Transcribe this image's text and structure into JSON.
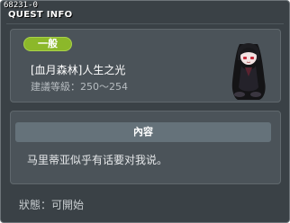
{
  "window": {
    "quest_id": "68231-0",
    "title": "QUEST INFO"
  },
  "quest": {
    "badge_label": "一般",
    "name": "[血月森林]人生之光",
    "level_label": "建議等級",
    "level_value": "250～254",
    "npc_portrait": "dark-haired-npc-portrait"
  },
  "content": {
    "header": "內容",
    "text": "马里蒂亚似乎有话要对我说。"
  },
  "status": {
    "label": "狀態",
    "value": "可開始"
  },
  "colors": {
    "window_bg": "#3a4146",
    "panel_bg": "#4b5359",
    "badge_green": "#8cb82a",
    "header_bar": "#65727a"
  }
}
